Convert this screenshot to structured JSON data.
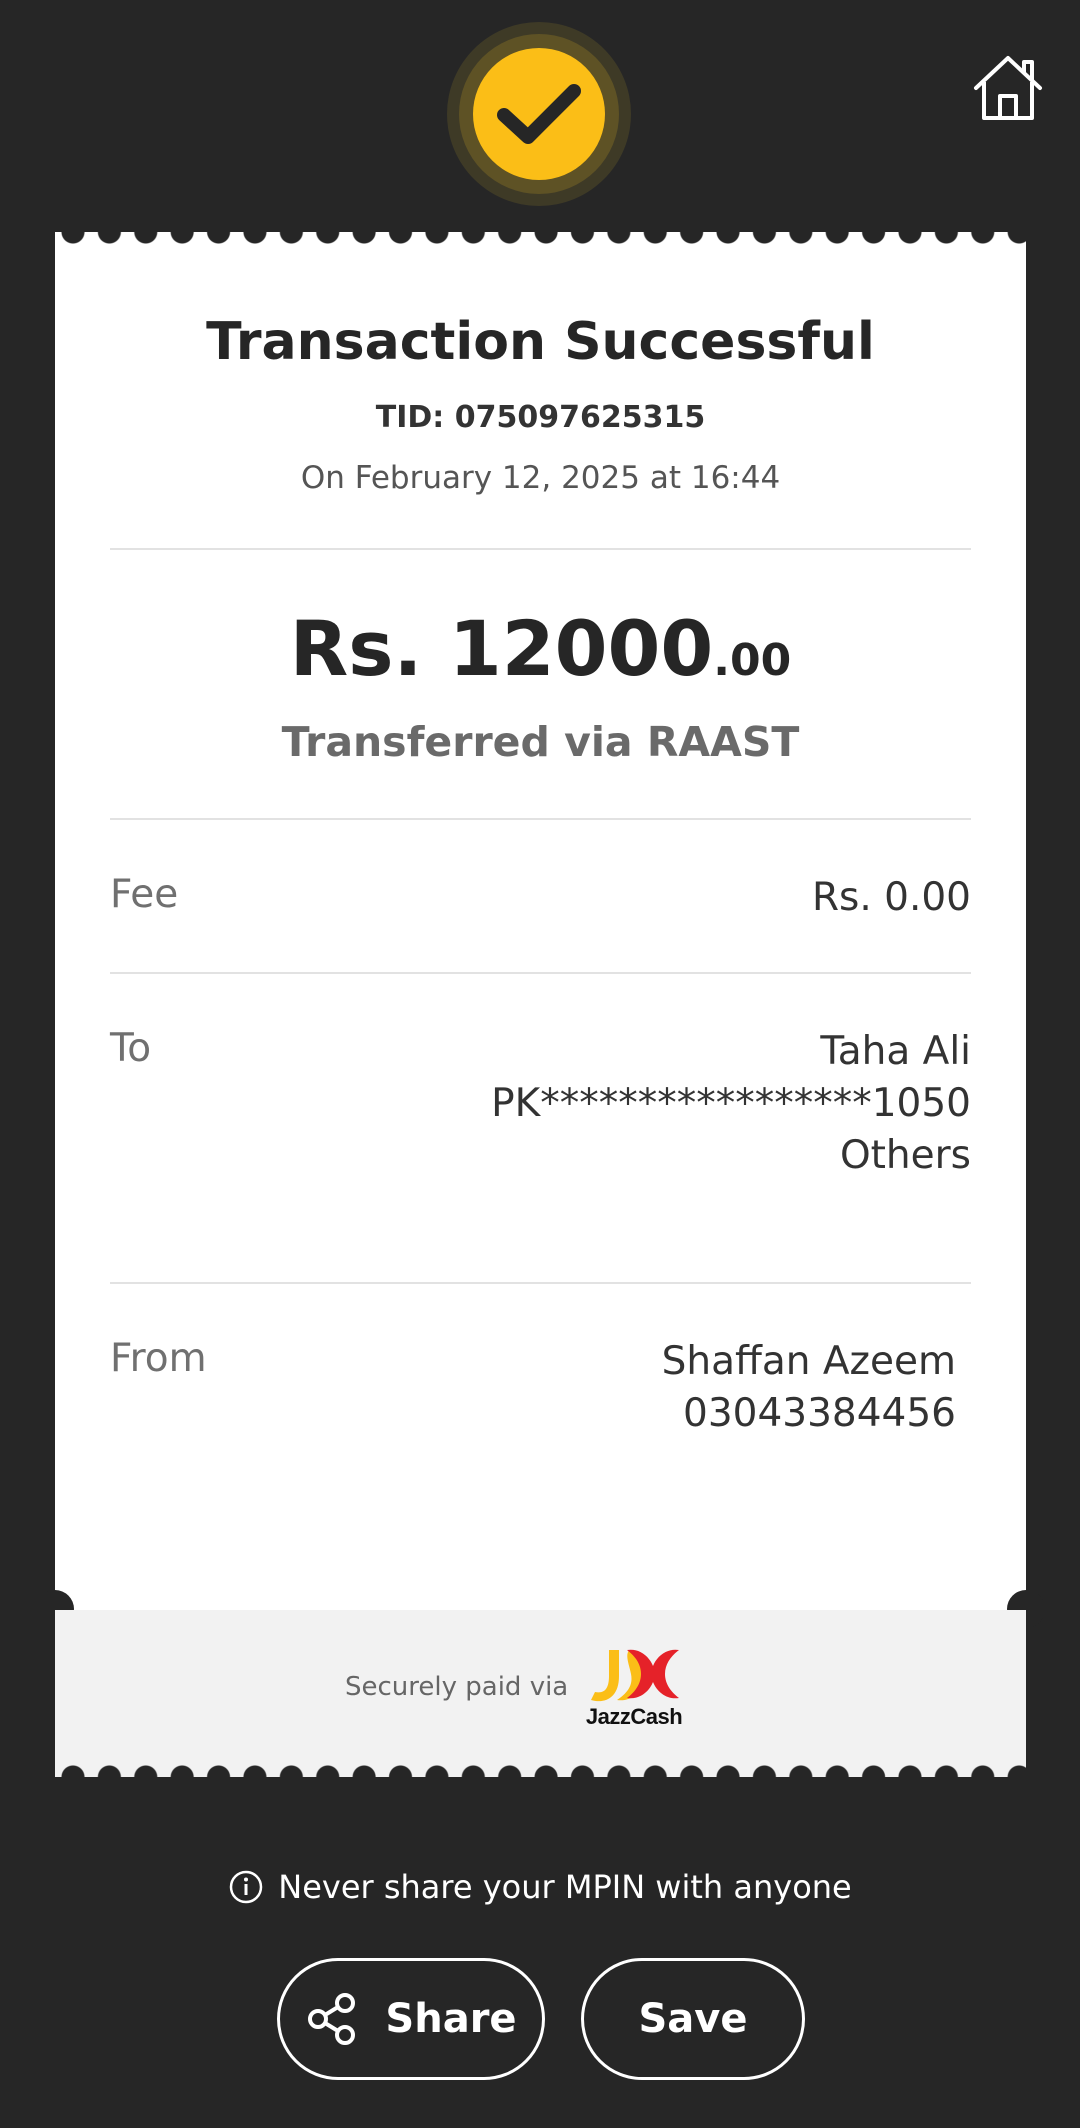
{
  "receipt": {
    "title": "Transaction Successful",
    "tid": "TID: 075097625315",
    "date": "On February 12, 2025 at 16:44",
    "amount_main": "Rs. 12000",
    "amount_decimal": ".00",
    "transfer_method": "Transferred via RAAST",
    "fee": {
      "label": "Fee",
      "value": "Rs. 0.00"
    },
    "to": {
      "label": "To",
      "name": "Taha Ali",
      "account": "PK*****************1050",
      "bank": "Others"
    },
    "from": {
      "label": "From",
      "name": "Shaffan Azeem",
      "number": "03043384456"
    }
  },
  "footer": {
    "secure_text": "Securely paid via",
    "brand": "JazzCash"
  },
  "warning": "Never share your MPIN with anyone",
  "actions": {
    "share_label": "Share",
    "save_label": "Save"
  },
  "icons": {
    "status": "checkmark-icon",
    "home": "home-icon",
    "info": "info-icon",
    "share": "share-icon"
  },
  "colors": {
    "background": "#262626",
    "accent": "#fbbe17",
    "card": "#ffffff"
  }
}
